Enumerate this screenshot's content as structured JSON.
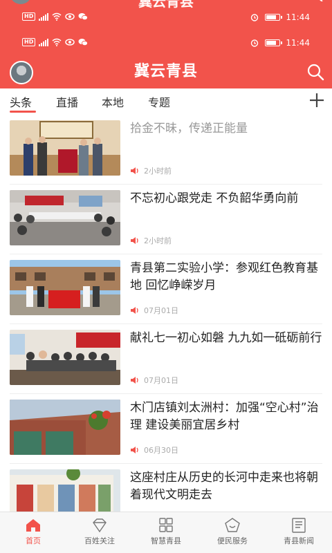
{
  "colors": {
    "brand": "#f2534b",
    "text": "#222222",
    "muted": "#aaaaaa"
  },
  "ghost": {
    "title": "冀云青县"
  },
  "status_bars": [
    {
      "hd": "HD",
      "network": "4G",
      "time": "11:44"
    },
    {
      "hd": "HD",
      "network": "4G",
      "time": "11:44"
    }
  ],
  "header": {
    "title": "冀云青县",
    "avatar_icon": "logo-avatar",
    "search_icon": "search-icon"
  },
  "tabs": {
    "items": [
      {
        "label": "头条",
        "active": true
      },
      {
        "label": "直播",
        "active": false
      },
      {
        "label": "本地",
        "active": false
      },
      {
        "label": "专题",
        "active": false
      }
    ],
    "add_icon": "plus-icon"
  },
  "feed": [
    {
      "title": "拾金不昧，传递正能量",
      "time": "2小时前",
      "read": true
    },
    {
      "title": "不忘初心跟党走 不负韶华勇向前",
      "time": "2小时前",
      "read": false
    },
    {
      "title": "青县第二实验小学：参观红色教育基地 回忆峥嵘岁月",
      "time": "07月01日",
      "read": false
    },
    {
      "title": "献礼七一初心如磐 九九如一砥砺前行",
      "time": "07月01日",
      "read": false
    },
    {
      "title": "木门店镇刘太洲村：加强“空心村”治理 建设美丽宜居乡村",
      "time": "06月30日",
      "read": false
    },
    {
      "title": "这座村庄从历史的长河中走来也将朝着现代文明走去",
      "time": "",
      "read": false
    }
  ],
  "bottom_nav": [
    {
      "label": "首页",
      "icon": "home-icon",
      "active": true
    },
    {
      "label": "百姓关注",
      "icon": "diamond-icon",
      "active": false
    },
    {
      "label": "智慧青县",
      "icon": "grid-icon",
      "active": false
    },
    {
      "label": "便民服务",
      "icon": "pentagon-icon",
      "active": false
    },
    {
      "label": "青县新闻",
      "icon": "newspaper-icon",
      "active": false
    }
  ]
}
